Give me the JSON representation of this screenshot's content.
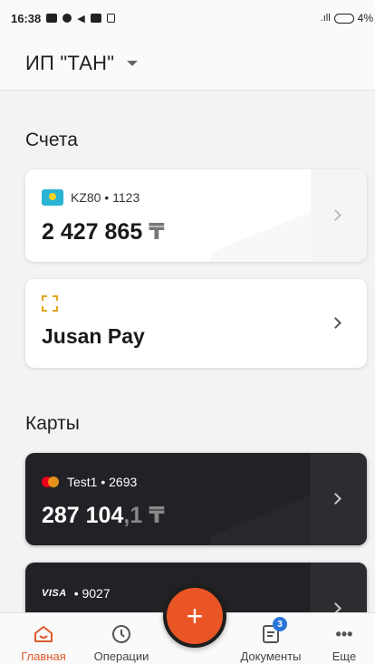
{
  "status_bar": {
    "time": "16:38",
    "battery": "4%"
  },
  "header": {
    "company": "ИП \"ТАН\""
  },
  "accounts_section": {
    "title": "Счета"
  },
  "accounts": [
    {
      "label": "KZ80 • 1123",
      "amount": "2 427 865",
      "currency": "₸"
    },
    {
      "label": "Jusan Pay"
    }
  ],
  "cards_section": {
    "title": "Карты"
  },
  "cards": [
    {
      "label": "Test1 • 2693",
      "amount_int": "287 104",
      "amount_frac": ",1",
      "currency": "₸",
      "brand_icon": "mastercard-icon"
    },
    {
      "label": "• 9027",
      "brand": "VISA",
      "brand_icon": "visa-icon"
    }
  ],
  "bottom_nav": {
    "items": [
      {
        "label": "Главная",
        "icon": "home-icon"
      },
      {
        "label": "Операции",
        "icon": "clock-icon"
      },
      {
        "label": "Документы",
        "icon": "document-icon",
        "badge": "3"
      },
      {
        "label": "Еще",
        "icon": "more-icon"
      }
    ],
    "fab": "+"
  },
  "colors": {
    "accent": "#e05a2b",
    "dark_card": "#222226",
    "badge": "#2a74d8"
  }
}
